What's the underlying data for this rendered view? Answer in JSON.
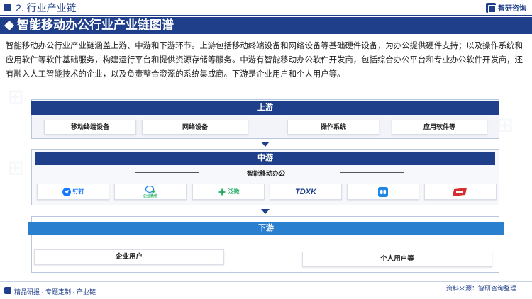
{
  "header": {
    "section_title": "2. 行业产业链",
    "logo_text": "智研咨询"
  },
  "title": "智能移动办公行业产业链图谱",
  "description": "智能移动办公行业产业链涵盖上游、中游和下游环节。上游包括移动终端设备和网络设备等基础硬件设备，为办公提供硬件支持；以及操作系统和应用软件等软件基础服务，构建运行平台和提供资源存储等服务。中游有智能移动办公软件开发商，包括综合办公平台和专业办公软件开发商，还有融入人工智能技术的企业，以及负责整合资源的系统集成商。下游是企业用户和个人用户等。",
  "upstream": {
    "label": "上游",
    "items": [
      "移动终端设备",
      "网络设备",
      "操作系统",
      "应用软件等"
    ]
  },
  "midstream": {
    "label": "中游",
    "sub_label": "智能移动办公",
    "logos": [
      {
        "name": "dingtalk",
        "text": "钉钉",
        "color": "#1677ff"
      },
      {
        "name": "wecom",
        "text": "企业微信",
        "color": "#2aae67"
      },
      {
        "name": "fanwei",
        "text": "泛微",
        "color": "#2aae67"
      },
      {
        "name": "tdxk",
        "text": "TDXK",
        "color": "#1f3f8a"
      },
      {
        "name": "app-blue",
        "text": "",
        "color": "#1e88e5"
      },
      {
        "name": "app-red",
        "text": "",
        "color": "#d32f2f"
      }
    ]
  },
  "downstream": {
    "label": "下游",
    "items": [
      "企业用户",
      "个人用户等"
    ]
  },
  "footer": {
    "left": "精品研报 · 专题定制 · 产业链",
    "right": "资料来源：智研咨询整理"
  },
  "colors": {
    "primary": "#1f3f8a",
    "upstream_head": "#1f3f8a",
    "midstream_head": "#1f3f8a",
    "downstream_head": "#2a7fcf"
  }
}
